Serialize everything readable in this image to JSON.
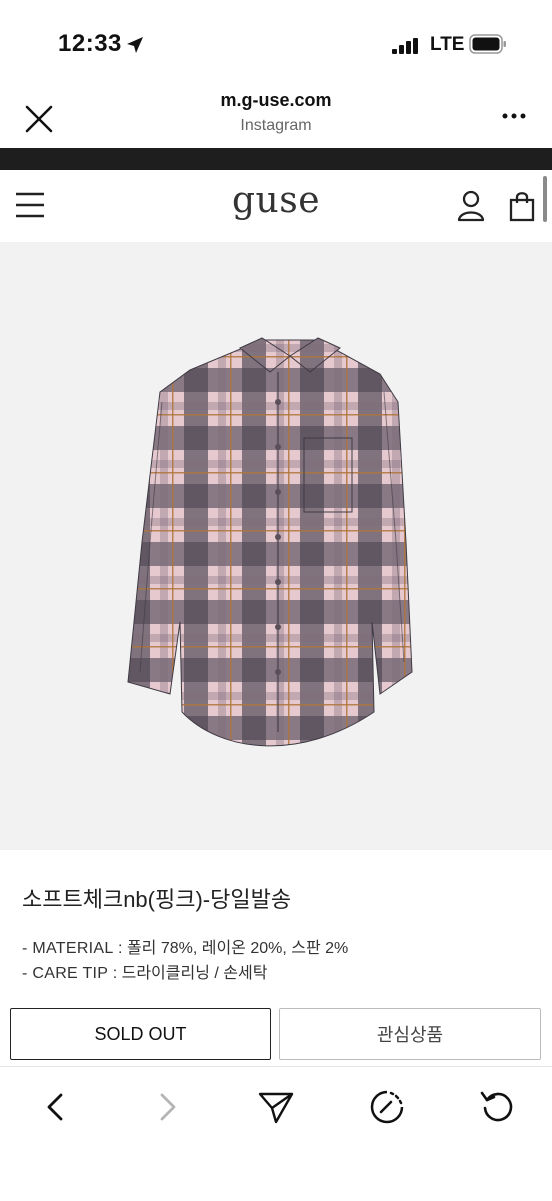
{
  "status_bar": {
    "time": "12:33",
    "network": "LTE",
    "icons": [
      "location-arrow-icon",
      "signal-bars-icon",
      "battery-icon"
    ]
  },
  "browser": {
    "host": "m.g-use.com",
    "source": "Instagram",
    "icons": [
      "close-icon",
      "more-icon"
    ]
  },
  "site": {
    "logo": "guse",
    "icons": [
      "hamburger-menu-icon",
      "user-icon",
      "shopping-bag-icon"
    ]
  },
  "product": {
    "name": "소프트체크nb(핑크)-당일발송",
    "image": "plaid-shirt-photo",
    "specs": [
      {
        "key": "- MATERIAL",
        "value": " : 폴리 78%, 레이온 20%, 스판 2%"
      },
      {
        "key": "- CARE TIP",
        "value": " : 드라이클리닝 / 손세탁"
      }
    ]
  },
  "actions": {
    "sold_out_label": "SOLD OUT",
    "wishlist_label": "관심상품"
  },
  "toolbar": {
    "icons": [
      "back-icon",
      "forward-icon",
      "share-icon",
      "speed-icon",
      "reload-icon"
    ]
  },
  "colors": {
    "band": "#1e1e1e",
    "image_bg": "#f2f2f2",
    "shirt_pink": "#e6c9cf",
    "shirt_dark": "#4b4552"
  }
}
